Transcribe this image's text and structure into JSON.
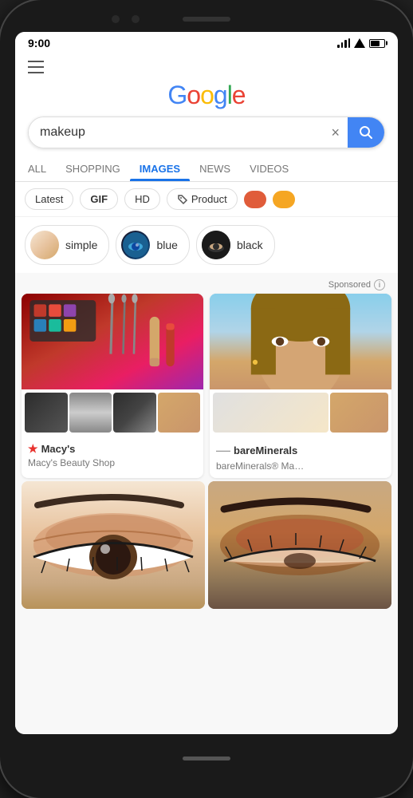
{
  "status": {
    "time": "9:00"
  },
  "header": {
    "menu_label": "≡",
    "google_letters": [
      "G",
      "o",
      "o",
      "g",
      "l",
      "e"
    ]
  },
  "search": {
    "value": "makeup",
    "clear_label": "×",
    "search_icon": "🔍"
  },
  "tabs": [
    {
      "label": "ALL",
      "active": false
    },
    {
      "label": "SHOPPING",
      "active": false
    },
    {
      "label": "IMAGES",
      "active": true
    },
    {
      "label": "NEWS",
      "active": false
    },
    {
      "label": "VIDEOS",
      "active": false
    }
  ],
  "filters": [
    {
      "label": "Latest",
      "type": "text"
    },
    {
      "label": "GIF",
      "type": "gif"
    },
    {
      "label": "HD",
      "type": "text"
    },
    {
      "label": "Product",
      "type": "product"
    },
    {
      "label": "",
      "type": "color",
      "color": "#e05c3a"
    },
    {
      "label": "",
      "type": "color",
      "color": "#f5a623"
    }
  ],
  "suggestions": [
    {
      "label": "simple",
      "bg": "pill-bg-1"
    },
    {
      "label": "blue",
      "bg": "pill-bg-2"
    },
    {
      "label": "black",
      "bg": "pill-bg-3"
    }
  ],
  "sponsored_label": "Sponsored",
  "cards": [
    {
      "brand": "Macy's",
      "subtitle": "Macy's Beauty Shop",
      "has_star": true
    },
    {
      "brand": "bareMinerals",
      "subtitle": "bareMinerals® Ma…",
      "has_star": false
    }
  ],
  "bottom_images": [
    {
      "label": "eye makeup 1"
    },
    {
      "label": "eye makeup 2"
    }
  ]
}
